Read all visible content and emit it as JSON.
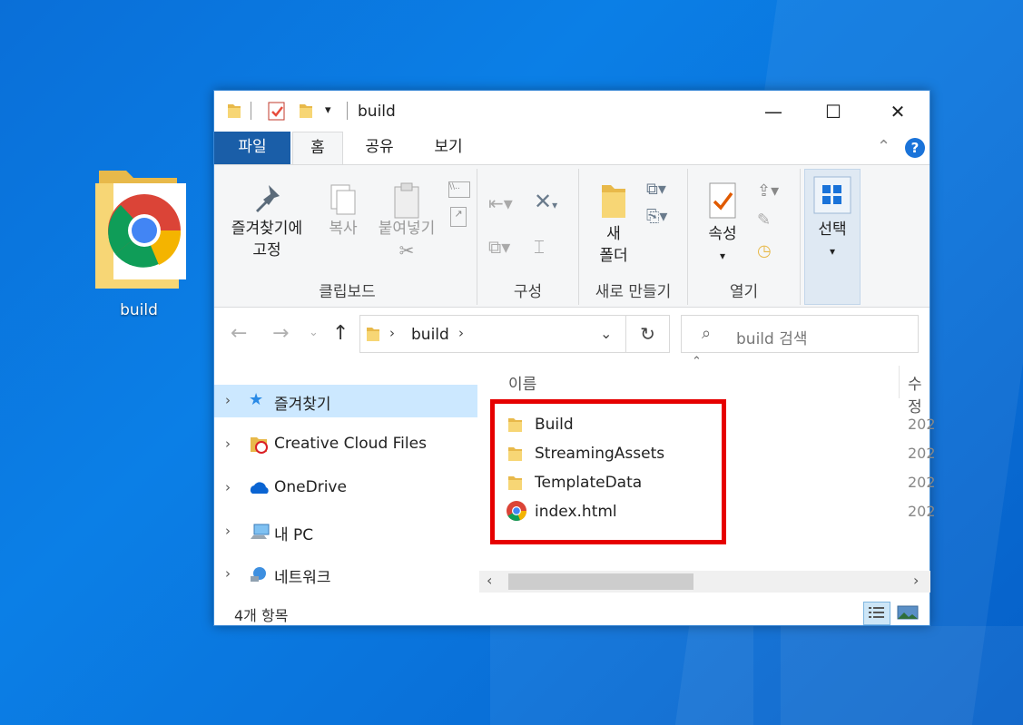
{
  "desktop": {
    "icon_label": "build"
  },
  "window": {
    "title": "build",
    "controls": {
      "minimize": "—",
      "maximize": "☐",
      "close": "✕"
    }
  },
  "ribbon_tabs": {
    "file": "파일",
    "home": "홈",
    "share": "공유",
    "view": "보기"
  },
  "ribbon": {
    "pin_line1": "즐겨찾기에",
    "pin_line2": "고정",
    "copy": "복사",
    "paste": "붙여넣기",
    "group_clipboard": "클립보드",
    "group_organize": "구성",
    "new_folder_line1": "새",
    "new_folder_line2": "폴더",
    "group_new": "새로 만들기",
    "properties": "속성",
    "group_open": "열기",
    "select": "선택"
  },
  "address": {
    "path": "build",
    "search_placeholder": "build 검색"
  },
  "nav": {
    "items": [
      {
        "label": "즐겨찾기"
      },
      {
        "label": "Creative Cloud Files"
      },
      {
        "label": "OneDrive"
      },
      {
        "label": "내 PC"
      },
      {
        "label": "네트워크"
      }
    ]
  },
  "content": {
    "col_name": "이름",
    "col_modified": "수정",
    "files": [
      {
        "name": "Build",
        "type": "folder",
        "date": "202"
      },
      {
        "name": "StreamingAssets",
        "type": "folder",
        "date": "202"
      },
      {
        "name": "TemplateData",
        "type": "folder",
        "date": "202"
      },
      {
        "name": "index.html",
        "type": "chrome",
        "date": "202"
      }
    ]
  },
  "status": {
    "item_count": "4개 항목"
  },
  "colors": {
    "accent": "#1a5ea8",
    "highlight": "#e60000",
    "nav_selected": "#cce8ff",
    "desktop": "#0a74dc"
  }
}
